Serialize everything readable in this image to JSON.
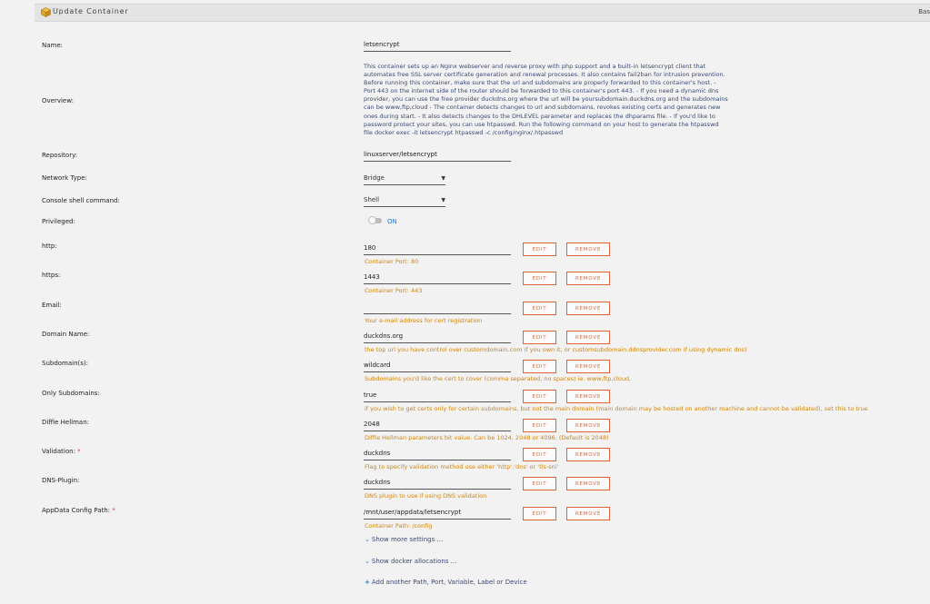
{
  "header": {
    "title": "Update Container",
    "right_text": "Bas"
  },
  "fields": {
    "name": {
      "label": "Name:",
      "value": "letsencrypt"
    },
    "overview": {
      "label": "Overview:",
      "text": "This container sets up an Nginx webserver and reverse proxy with php support and a built-in letsencrypt client that automates free SSL server certificate generation and renewal processes. It also contains fail2ban for intrusion prevention. Before running this container, make sure that the url and subdomains are properly forwarded to this container's host. - Port 443 on the internet side of the router should be forwarded to this container's port 443. - If you need a dynamic dns provider, you can use the free provider duckdns.org where the url will be yoursubdomain.duckdns.org and the subdomains can be www,ftp,cloud - The container detects changes to url and subdomains, revokes existing certs and generates new ones during start. - It also detects changes to the DHLEVEL parameter and replaces the dhparams file. - If you'd like to password protect your sites, you can use htpasswd. Run the following command on your host to generate the htpasswd file docker exec -it letsencrypt htpasswd -c /config/nginx/.htpasswd"
    },
    "repository": {
      "label": "Repository:",
      "value": "linuxserver/letsencrypt"
    },
    "network_type": {
      "label": "Network Type:",
      "value": "Bridge"
    },
    "console": {
      "label": "Console shell command:",
      "value": "Shell"
    },
    "privileged": {
      "label": "Privileged:",
      "state": "ON"
    }
  },
  "buttons": {
    "edit": "EDIT",
    "remove": "REMOVE"
  },
  "configs": [
    {
      "label": "http:",
      "required": false,
      "value": "180",
      "hint": "Container Port: 80"
    },
    {
      "label": "https:",
      "required": false,
      "value": "1443",
      "hint": "Container Port: 443"
    },
    {
      "label": "Email:",
      "required": false,
      "value": "",
      "hint": "Your e-mail address for cert registration"
    },
    {
      "label": "Domain Name:",
      "required": false,
      "value": "duckdns.org",
      "hint": "the top url you have control over customdomain.com if you own it, or customsubdomain.ddnsprovider.com if using dynamic dns)"
    },
    {
      "label": "Subdomain(s):",
      "required": false,
      "value": "wildcard",
      "hint": "Subdomains you'd like the cert to cover (comma separated, no spaces) ie. www,ftp,cloud,"
    },
    {
      "label": "Only Subdomains:",
      "required": false,
      "value": "true",
      "hint": "if you wish to get certs only for certain subdomains, but not the main domain (main domain may be hosted on another machine and cannot be validated), set this to true"
    },
    {
      "label": "Diffie Hellman:",
      "required": false,
      "value": "2048",
      "hint": "Diffie Hellman parameters bit value. Can be 1024, 2048 or 4096. (Default is 2048)"
    },
    {
      "label": "Validation:",
      "required": true,
      "value": "duckdns",
      "hint": "Flag to specify validation method use either 'http','dns' or 'tls-sni'"
    },
    {
      "label": "DNS-Plugin:",
      "required": false,
      "value": "duckdns",
      "hint": "DNS plugin to use if using DNS validation"
    },
    {
      "label": "AppData Config Path:",
      "required": true,
      "value": "/mnt/user/appdata/letsencrypt",
      "hint": "Container Path: /config"
    }
  ],
  "links": {
    "more_settings": "Show more settings ...",
    "docker_allocations": "Show docker allocations ...",
    "add_another": "Add another Path, Port, Variable, Label or Device"
  },
  "colors": {
    "accent_orange": "#e0603a",
    "hint_orange": "#d0850d",
    "link_blue": "#1e77d3",
    "overview_text": "#3b4a76"
  },
  "icons": {
    "header": "package-icon",
    "chevron": "chevron-down-icon",
    "plus": "plus-icon"
  }
}
